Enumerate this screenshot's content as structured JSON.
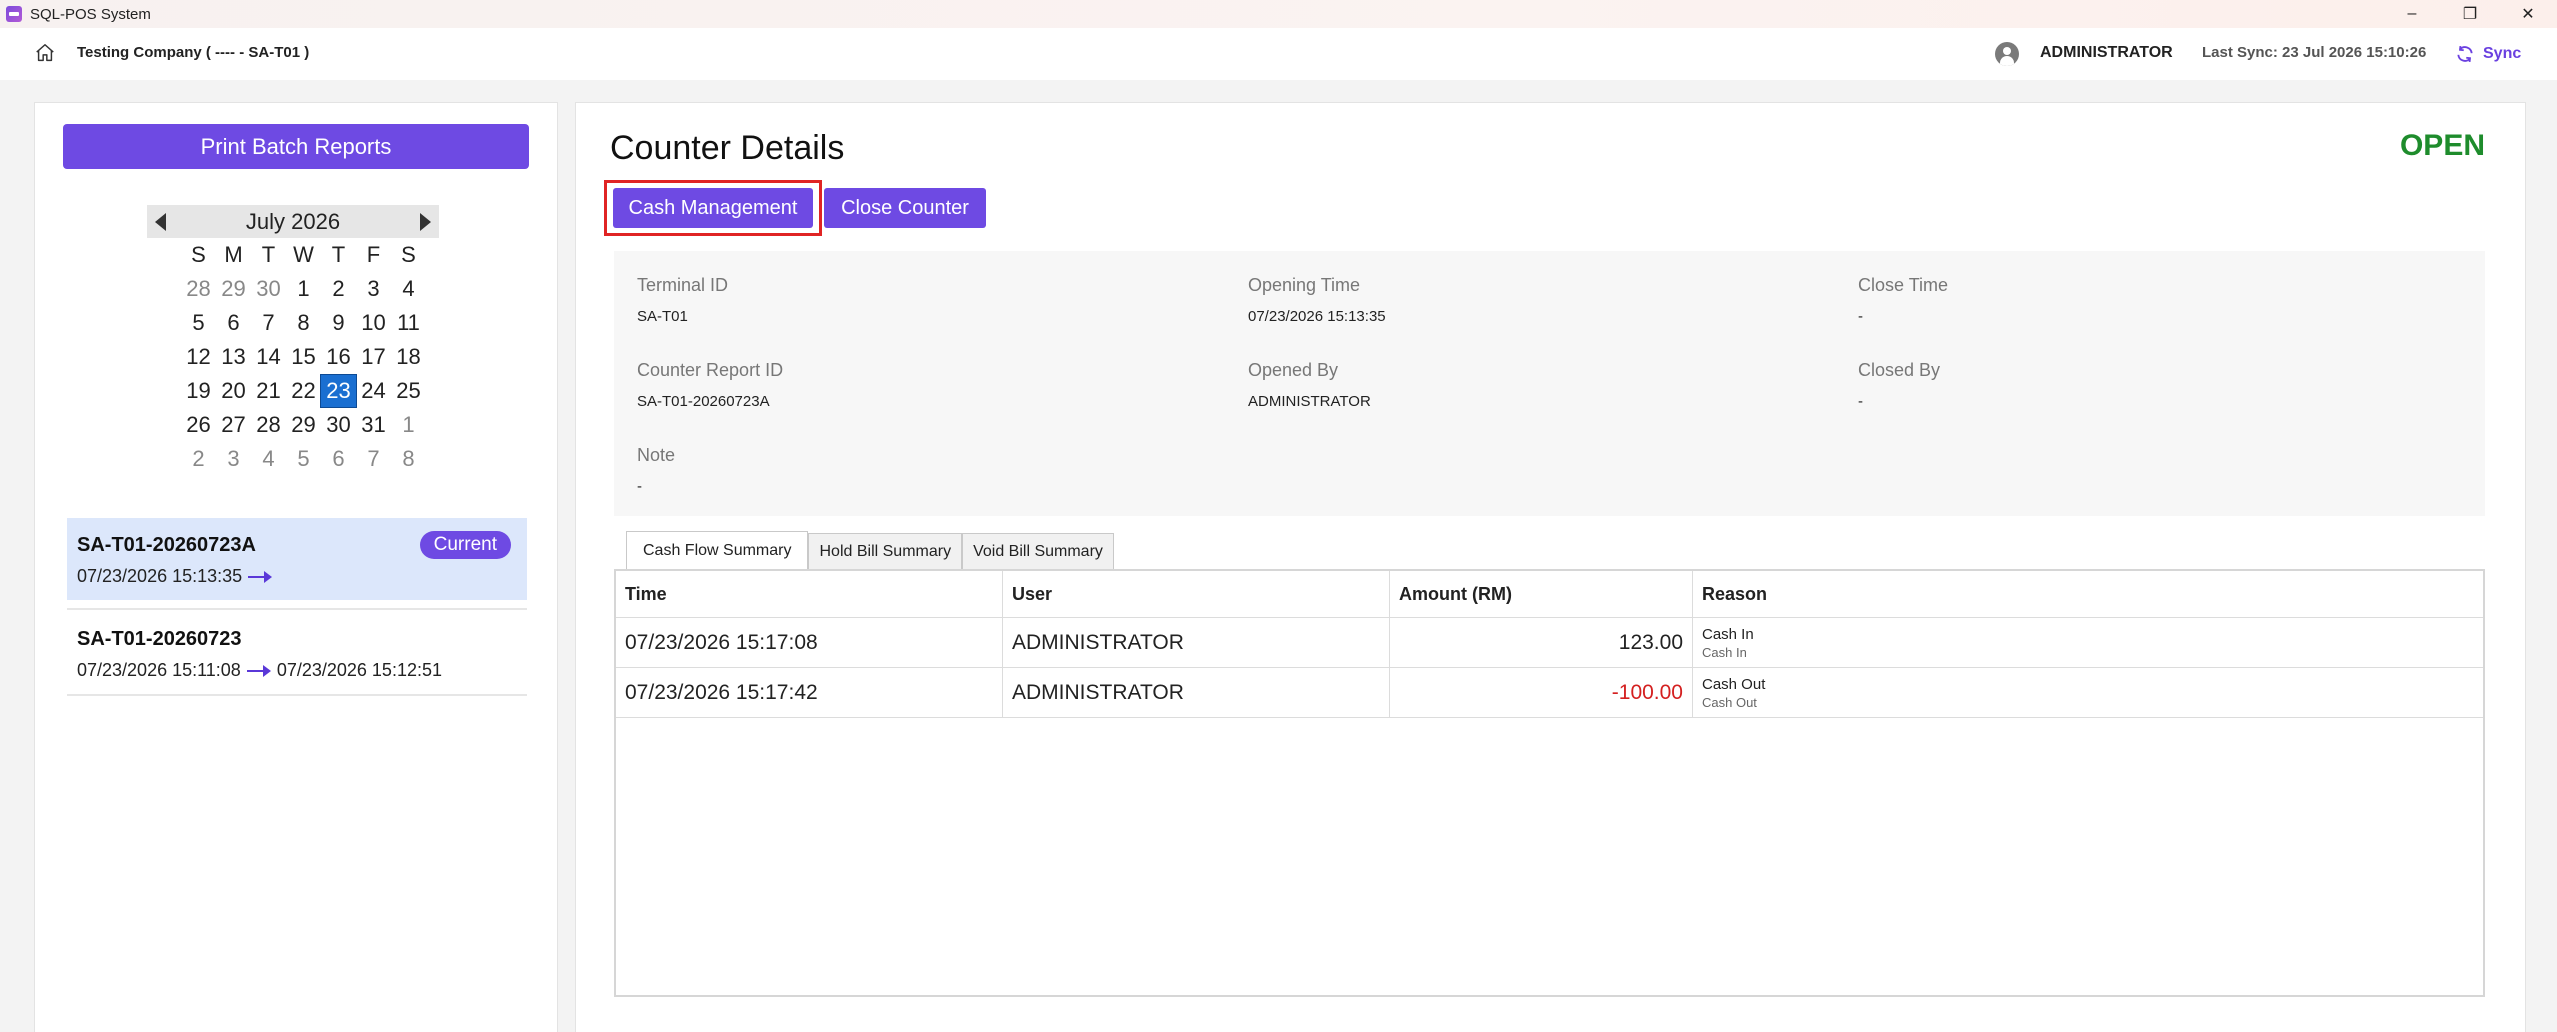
{
  "window": {
    "title": "SQL-POS System",
    "controls": [
      "–",
      "❐",
      "✕"
    ]
  },
  "header": {
    "company": "Testing Company ( ---- - SA-T01 )",
    "user": "ADMINISTRATOR",
    "last_sync": "Last Sync: 23 Jul 2026 15:10:26",
    "sync_label": "Sync"
  },
  "left": {
    "print_label": "Print Batch Reports",
    "calendar": {
      "month": "July 2026",
      "days_of_week": [
        "S",
        "M",
        "T",
        "W",
        "T",
        "F",
        "S"
      ],
      "weeks": [
        [
          "28",
          "29",
          "30",
          "1",
          "2",
          "3",
          "4"
        ],
        [
          "5",
          "6",
          "7",
          "8",
          "9",
          "10",
          "11"
        ],
        [
          "12",
          "13",
          "14",
          "15",
          "16",
          "17",
          "18"
        ],
        [
          "19",
          "20",
          "21",
          "22",
          "23",
          "24",
          "25"
        ],
        [
          "26",
          "27",
          "28",
          "29",
          "30",
          "31",
          "1"
        ],
        [
          "2",
          "3",
          "4",
          "5",
          "6",
          "7",
          "8"
        ]
      ],
      "selected": "23"
    },
    "sessions": [
      {
        "id": "SA-T01-20260723A",
        "start": "07/23/2026 15:13:35",
        "end": "",
        "badge": "Current"
      },
      {
        "id": "SA-T01-20260723",
        "start": "07/23/2026 15:11:08",
        "end": "07/23/2026 15:12:51",
        "badge": ""
      }
    ]
  },
  "main": {
    "title": "Counter Details",
    "status": "OPEN",
    "status_color": "#1e8c2c",
    "accent_color": "#6e4ae3",
    "cash_management_label": "Cash Management",
    "close_counter_label": "Close Counter",
    "fields": {
      "terminal_id": {
        "label": "Terminal ID",
        "value": "SA-T01"
      },
      "opening_time": {
        "label": "Opening Time",
        "value": "07/23/2026 15:13:35"
      },
      "close_time": {
        "label": "Close Time",
        "value": "-"
      },
      "counter_report_id": {
        "label": "Counter Report ID",
        "value": "SA-T01-20260723A"
      },
      "opened_by": {
        "label": "Opened By",
        "value": "ADMINISTRATOR"
      },
      "closed_by": {
        "label": "Closed By",
        "value": "-"
      },
      "note": {
        "label": "Note",
        "value": "-"
      }
    },
    "tabs": [
      "Cash Flow Summary",
      "Hold Bill Summary",
      "Void Bill Summary"
    ],
    "table": {
      "columns": [
        "Time",
        "User",
        "Amount (RM)",
        "Reason"
      ],
      "rows": [
        {
          "time": "07/23/2026 15:17:08",
          "user": "ADMINISTRATOR",
          "amount": "123.00",
          "reason": "Cash In",
          "reason_sub": "Cash In"
        },
        {
          "time": "07/23/2026 15:17:42",
          "user": "ADMINISTRATOR",
          "amount": "-100.00",
          "reason": "Cash Out",
          "reason_sub": "Cash Out"
        }
      ]
    }
  }
}
